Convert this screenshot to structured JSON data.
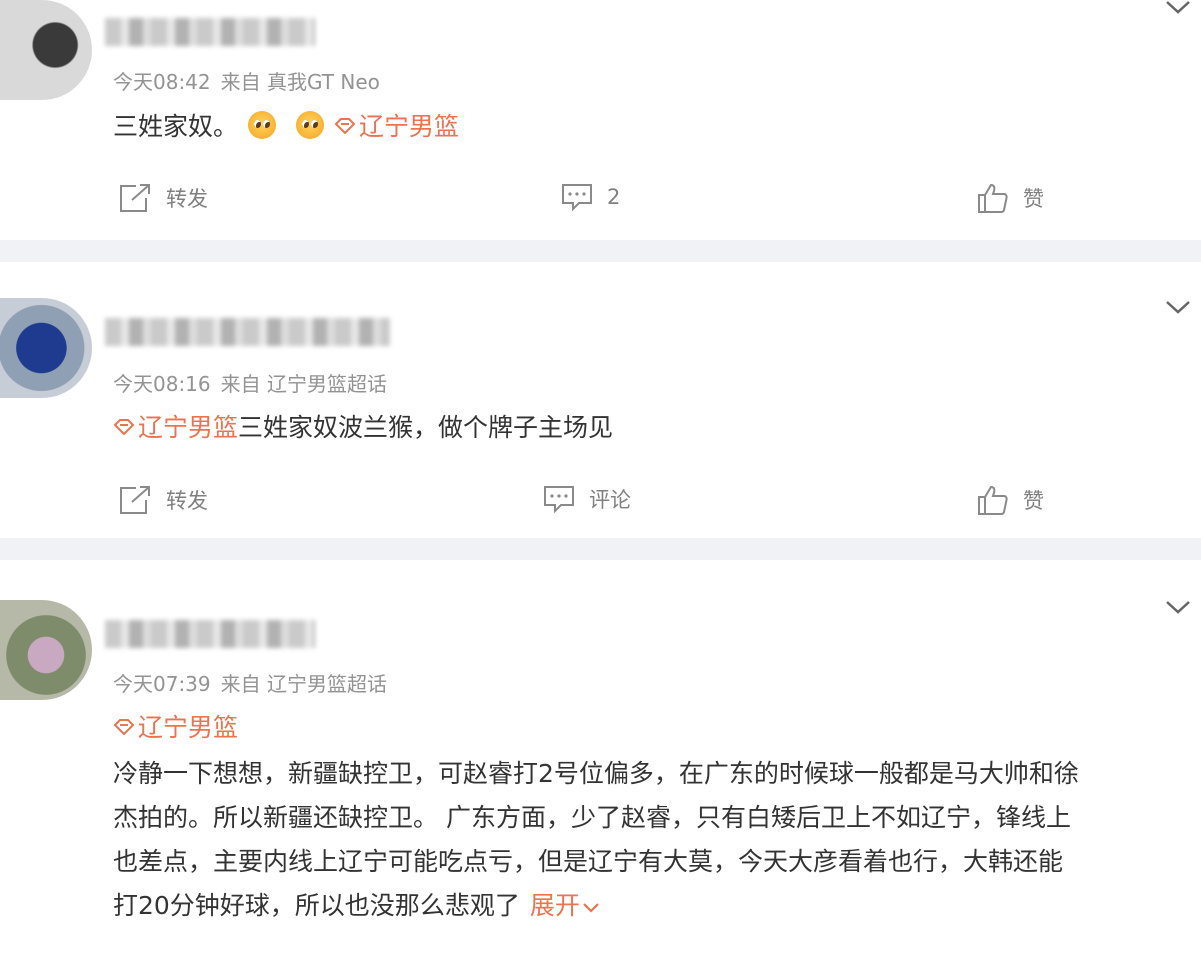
{
  "posts": [
    {
      "time": "今天08:42",
      "source": "来自 真我GT Neo",
      "text": "三姓家奴。",
      "topic": "辽宁男篮",
      "actions": {
        "repost": "转发",
        "comment": "2",
        "like": "赞"
      }
    },
    {
      "time": "今天08:16",
      "source": "来自 辽宁男篮超话",
      "topic": "辽宁男篮",
      "text": "三姓家奴波兰猴，做个牌子主场见",
      "actions": {
        "repost": "转发",
        "comment": "评论",
        "like": "赞"
      }
    },
    {
      "time": "今天07:39",
      "source": "来自 辽宁男篮超话",
      "topic": "辽宁男篮",
      "text": "冷静一下想想，新疆缺控卫，可赵睿打2号位偏多，在广东的时候球一般都是马大帅和徐\n杰拍的。所以新疆还缺控卫。 广东方面，少了赵睿，只有白矮后卫上不如辽宁，锋线上\n也差点，主要内线上辽宁可能吃点亏，但是辽宁有大莫，今天大彦看着也行，大韩还能\n打20分钟好球，所以也没那么悲观了",
      "expand": "展开"
    }
  ],
  "icons": [
    "repost-icon",
    "comment-icon",
    "like-icon",
    "chevron-down-icon",
    "topic-icon"
  ],
  "colors": {
    "accent": "#eb7350",
    "meta": "#939393",
    "separator": "#f1f2f5"
  }
}
